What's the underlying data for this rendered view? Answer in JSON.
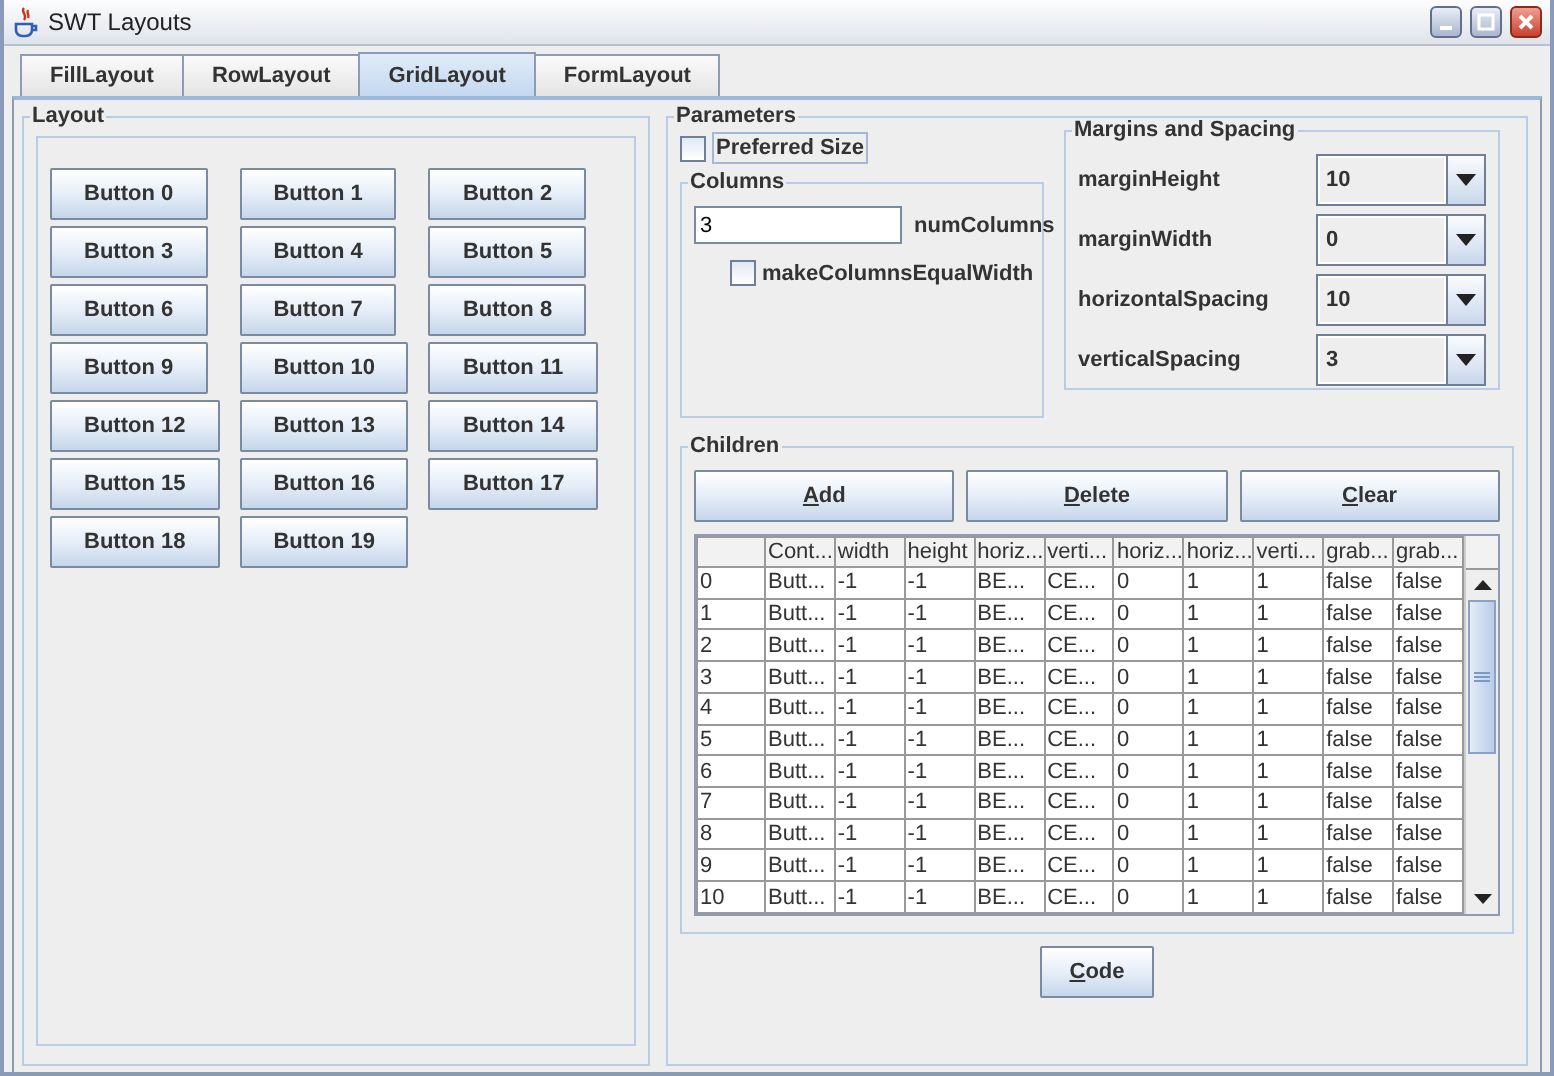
{
  "window": {
    "title": "SWT Layouts"
  },
  "tabs": [
    {
      "label": "FillLayout",
      "selected": false
    },
    {
      "label": "RowLayout",
      "selected": false
    },
    {
      "label": "GridLayout",
      "selected": true
    },
    {
      "label": "FormLayout",
      "selected": false
    }
  ],
  "layout_panel": {
    "title": "Layout",
    "buttons": [
      "Button 0",
      "Button 1",
      "Button 2",
      "Button 3",
      "Button 4",
      "Button 5",
      "Button 6",
      "Button 7",
      "Button 8",
      "Button 9",
      "Button 10",
      "Button 11",
      "Button 12",
      "Button 13",
      "Button 14",
      "Button 15",
      "Button 16",
      "Button 17",
      "Button 18",
      "Button 19"
    ]
  },
  "parameters": {
    "title": "Parameters",
    "preferred_size": {
      "label": "Preferred Size",
      "checked": false,
      "focused": true
    },
    "columns": {
      "title": "Columns",
      "num_columns": {
        "value": "3",
        "label": "numColumns"
      },
      "equal_width": {
        "label": "makeColumnsEqualWidth",
        "checked": false
      }
    },
    "margins": {
      "title": "Margins and Spacing",
      "fields": [
        {
          "label": "marginHeight",
          "value": "10"
        },
        {
          "label": "marginWidth",
          "value": "0"
        },
        {
          "label": "horizontalSpacing",
          "value": "10"
        },
        {
          "label": "verticalSpacing",
          "value": "3"
        }
      ]
    },
    "children": {
      "title": "Children",
      "buttons": [
        {
          "label": "Add",
          "mnemonic": true
        },
        {
          "label": "Delete",
          "mnemonic": true
        },
        {
          "label": "Clear",
          "mnemonic": true
        }
      ],
      "table": {
        "columns": [
          "",
          "Cont...",
          "width",
          "height",
          "horiz...",
          "verti...",
          "horiz...",
          "horiz...",
          "verti...",
          "grab...",
          "grab..."
        ],
        "rows": [
          [
            "0",
            "Butt...",
            "-1",
            "-1",
            "BE...",
            "CE...",
            "0",
            "1",
            "1",
            "false",
            "false"
          ],
          [
            "1",
            "Butt...",
            "-1",
            "-1",
            "BE...",
            "CE...",
            "0",
            "1",
            "1",
            "false",
            "false"
          ],
          [
            "2",
            "Butt...",
            "-1",
            "-1",
            "BE...",
            "CE...",
            "0",
            "1",
            "1",
            "false",
            "false"
          ],
          [
            "3",
            "Butt...",
            "-1",
            "-1",
            "BE...",
            "CE...",
            "0",
            "1",
            "1",
            "false",
            "false"
          ],
          [
            "4",
            "Butt...",
            "-1",
            "-1",
            "BE...",
            "CE...",
            "0",
            "1",
            "1",
            "false",
            "false"
          ],
          [
            "5",
            "Butt...",
            "-1",
            "-1",
            "BE...",
            "CE...",
            "0",
            "1",
            "1",
            "false",
            "false"
          ],
          [
            "6",
            "Butt...",
            "-1",
            "-1",
            "BE...",
            "CE...",
            "0",
            "1",
            "1",
            "false",
            "false"
          ],
          [
            "7",
            "Butt...",
            "-1",
            "-1",
            "BE...",
            "CE...",
            "0",
            "1",
            "1",
            "false",
            "false"
          ],
          [
            "8",
            "Butt...",
            "-1",
            "-1",
            "BE...",
            "CE...",
            "0",
            "1",
            "1",
            "false",
            "false"
          ],
          [
            "9",
            "Butt...",
            "-1",
            "-1",
            "BE...",
            "CE...",
            "0",
            "1",
            "1",
            "false",
            "false"
          ],
          [
            "10",
            "Butt...",
            "-1",
            "-1",
            "BE...",
            "CE...",
            "0",
            "1",
            "1",
            "false",
            "false"
          ]
        ]
      }
    },
    "code_button": {
      "label": "Code",
      "mnemonic": true
    }
  }
}
